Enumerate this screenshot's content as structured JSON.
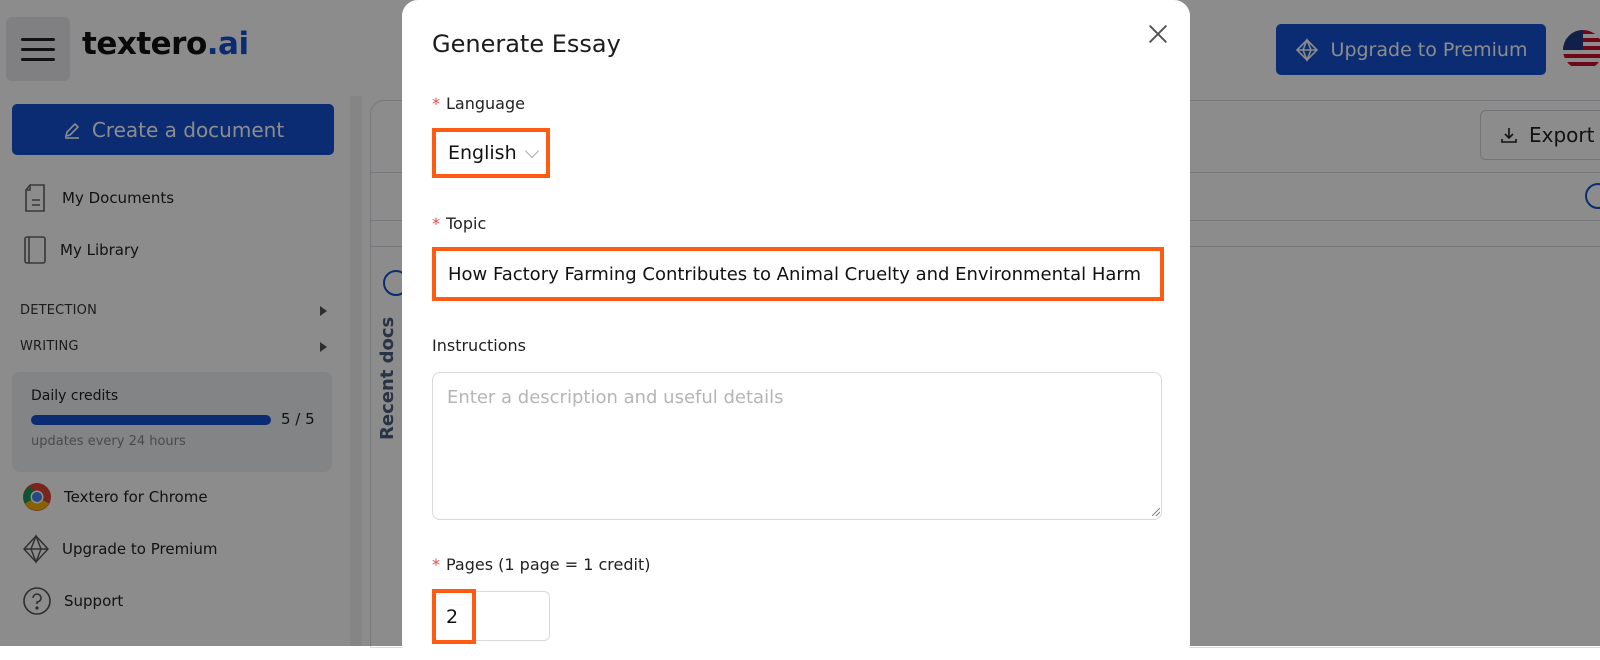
{
  "app": {
    "logo_text": "textero",
    "logo_suffix": ".ai"
  },
  "header": {
    "upgrade_label": "Upgrade to Premium"
  },
  "sidebar": {
    "create_label": "Create a document",
    "items": [
      {
        "label": "My Documents",
        "icon": "document-icon"
      },
      {
        "label": "My Library",
        "icon": "book-icon"
      }
    ],
    "sections": [
      "DETECTION",
      "WRITING"
    ],
    "credits": {
      "title": "Daily credits",
      "count": "5 / 5",
      "progress_fraction": 1.0,
      "subtitle": "updates every 24 hours"
    },
    "footer_items": [
      {
        "label": "Textero for Chrome",
        "icon": "chrome-icon"
      },
      {
        "label": "Upgrade to Premium",
        "icon": "diamond-icon"
      },
      {
        "label": "Support",
        "icon": "help-icon"
      }
    ]
  },
  "content": {
    "export_label": "Export",
    "recent_docs_label": "Recent docs"
  },
  "modal": {
    "title": "Generate Essay",
    "language": {
      "label": "Language",
      "value": "English"
    },
    "topic": {
      "label": "Topic",
      "value": "How Factory Farming Contributes to Animal Cruelty and Environmental Harm"
    },
    "instructions": {
      "label": "Instructions",
      "placeholder": "Enter a description and useful details"
    },
    "pages": {
      "label": "Pages (1 page = 1 credit)",
      "value": "2"
    }
  },
  "colors": {
    "brand_blue": "#1550d2",
    "highlight_orange": "#ff5b12",
    "required_red": "#e5484d"
  }
}
